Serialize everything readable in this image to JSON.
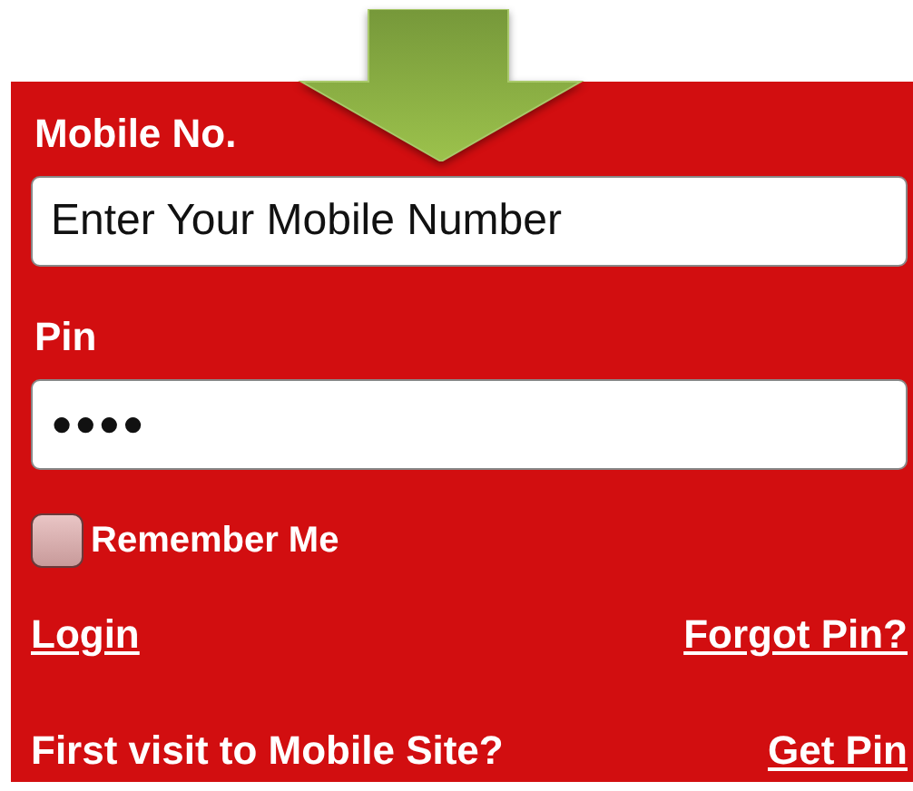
{
  "form": {
    "fields": [
      {
        "label": "Mobile No.",
        "value": "Enter Your Mobile Number"
      },
      {
        "label": "Pin",
        "value": "●●●●"
      }
    ],
    "remember": {
      "label": "Remember Me",
      "checked": false
    },
    "links": [
      {
        "label": "Login"
      },
      {
        "label": "Forgot Pin?"
      }
    ],
    "footer": {
      "text": "First visit to Mobile Site?",
      "link": "Get Pin"
    }
  }
}
